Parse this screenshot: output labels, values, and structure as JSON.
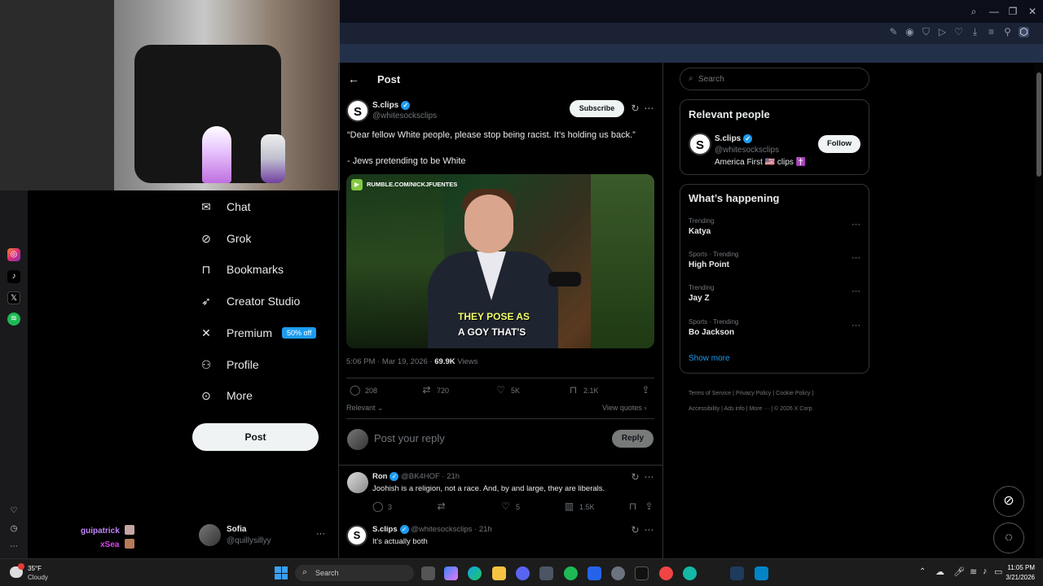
{
  "browser": {
    "window_controls": [
      "search",
      "minimize",
      "restore",
      "maximize",
      "close"
    ]
  },
  "sidebar": {
    "items": [
      {
        "label": "Chat",
        "icon": "mail-icon"
      },
      {
        "label": "Grok",
        "icon": "grok-icon"
      },
      {
        "label": "Bookmarks",
        "icon": "bookmark-icon"
      },
      {
        "label": "Creator Studio",
        "icon": "rocket-icon"
      },
      {
        "label": "Premium",
        "icon": "x-logo-icon",
        "badge": "50% off"
      },
      {
        "label": "Profile",
        "icon": "person-icon"
      },
      {
        "label": "More",
        "icon": "more-circle-icon"
      }
    ],
    "post_button": "Post",
    "account": {
      "name": "Sofia",
      "handle": "@quillysillyy",
      "more": "···"
    }
  },
  "stream_overlay": {
    "viewers": [
      "guipatrick",
      "xSea"
    ]
  },
  "header": {
    "back": "←",
    "title": "Post"
  },
  "post": {
    "author": "S.clips",
    "handle": "@whitesocksclips",
    "subscribe": "Subscribe",
    "text_line1": "“Dear fellow White people, please stop being racist. It’s holding us back.”",
    "text_line2": "- Jews pretending to be White",
    "media": {
      "watermark": "RUMBLE.COM/NICKJFUENTES",
      "caption_line1": "THEY POSE AS",
      "caption_line2": "A GOY THAT'S"
    },
    "time": "5:06 PM · Mar 19, 2026 · ",
    "views_count": "69.9K",
    "views_label": " Views",
    "replies": "208",
    "reposts": "720",
    "likes": "5K",
    "bookmarks": "2.1K",
    "sort": "Relevant",
    "view_quotes": "View quotes"
  },
  "reply_box": {
    "placeholder": "Post your reply",
    "button": "Reply"
  },
  "replies": [
    {
      "author": "Ron",
      "handle": "@BK4HOF",
      "time": "· 21h",
      "text": "Joohish is a religion, not a race. And, by and large, they are liberals.",
      "replies": "3",
      "reposts": "",
      "likes": "5",
      "views": "1.5K"
    },
    {
      "author": "S.clips",
      "handle": "@whitesocksclips",
      "time": "· 21h",
      "text": "It's actually both"
    }
  ],
  "search": {
    "placeholder": "Search"
  },
  "relevant_people": {
    "title": "Relevant people",
    "name": "S.clips",
    "handle": "@whitesocksclips",
    "bio": "America First 🇺🇸 clips ✝️",
    "follow": "Follow"
  },
  "whats_happening": {
    "title": "What’s happening",
    "trends": [
      {
        "category": "Trending",
        "name": "Katya"
      },
      {
        "category": "Sports · Trending",
        "name": "High Point"
      },
      {
        "category": "Trending",
        "name": "Jay Z"
      },
      {
        "category": "Sports · Trending",
        "name": "Bo Jackson"
      }
    ],
    "show_more": "Show more"
  },
  "footer": {
    "links": [
      "Terms of Service",
      "Privacy Policy",
      "Cookie Policy",
      "Accessibility",
      "Ads info",
      "More ···",
      "© 2026 X Corp."
    ]
  },
  "taskbar": {
    "weather_temp": "35°F",
    "weather_desc": "Cloudy",
    "search": "Search",
    "time": "11:05 PM",
    "date": "3/21/2026"
  }
}
